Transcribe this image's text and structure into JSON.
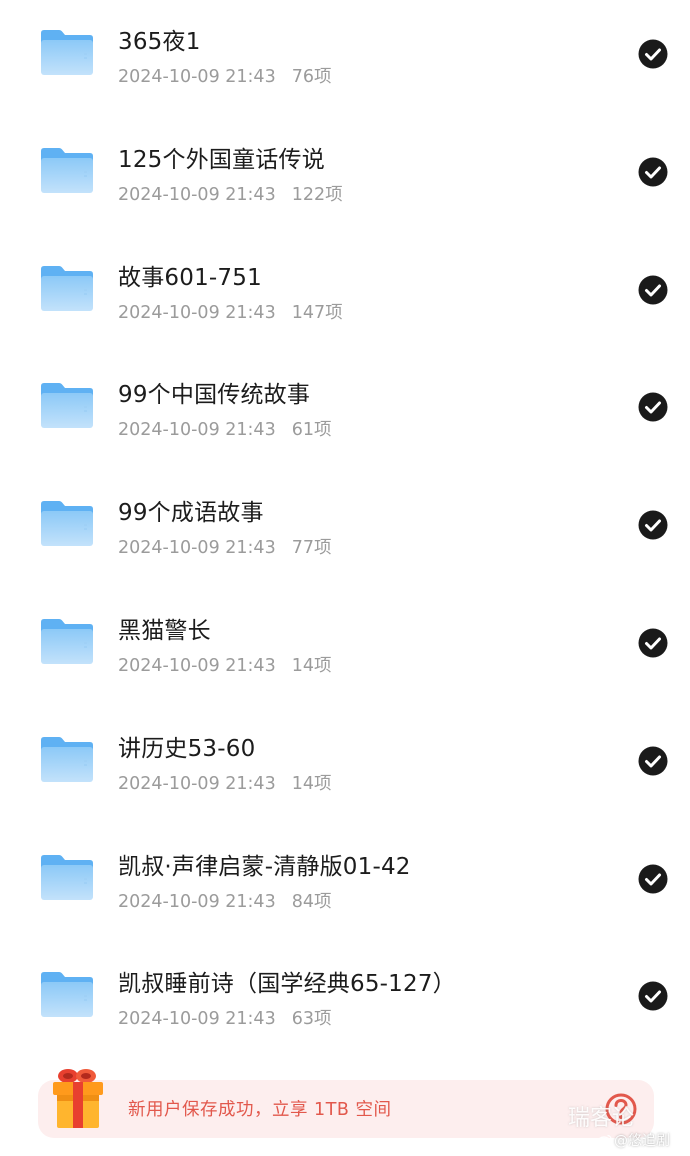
{
  "files": [
    {
      "name": "365夜1",
      "date": "2024-10-09 21:43",
      "count": "76项",
      "selected": true
    },
    {
      "name": "125个外国童话传说",
      "date": "2024-10-09 21:43",
      "count": "122项",
      "selected": true
    },
    {
      "name": "故事601-751",
      "date": "2024-10-09 21:43",
      "count": "147项",
      "selected": true
    },
    {
      "name": "99个中国传统故事",
      "date": "2024-10-09 21:43",
      "count": "61项",
      "selected": true
    },
    {
      "name": "99个成语故事",
      "date": "2024-10-09 21:43",
      "count": "77项",
      "selected": true
    },
    {
      "name": "黑猫警长",
      "date": "2024-10-09 21:43",
      "count": "14项",
      "selected": true
    },
    {
      "name": "讲历史53-60",
      "date": "2024-10-09 21:43",
      "count": "14项",
      "selected": true
    },
    {
      "name": "凯叔·声律启蒙-清静版01-42",
      "date": "2024-10-09 21:43",
      "count": "84项",
      "selected": true
    },
    {
      "name": "凯叔睡前诗（国学经典65-127）",
      "date": "2024-10-09 21:43",
      "count": "63项",
      "selected": true
    }
  ],
  "banner": {
    "text": "新用户保存成功，立享 1TB 空间",
    "gift_icon": "gift-box-icon",
    "help_icon": "question-circle-icon"
  },
  "watermark": {
    "text": "瑞客论",
    "credit": "@悠追剧"
  },
  "icons": {
    "folder": "folder-icon",
    "check": "check-circle-icon"
  },
  "colors": {
    "folder_light": "#bfe0fb",
    "folder_dark": "#5fb1f3",
    "check_fill": "#1a1a1a",
    "banner_bg": "#fdeeee",
    "banner_text": "#e2584c"
  }
}
